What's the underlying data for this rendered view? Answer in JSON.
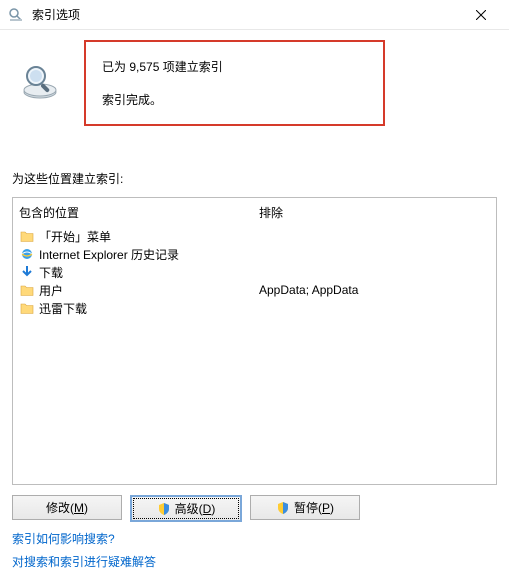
{
  "window": {
    "title": "索引选项"
  },
  "status": {
    "line1": "已为 9,575 项建立索引",
    "line2": "索引完成。"
  },
  "section_label": "为这些位置建立索引:",
  "columns": {
    "include": "包含的位置",
    "exclude": "排除"
  },
  "locations": [
    {
      "icon": "folder",
      "label": "「开始」菜单",
      "exclude": ""
    },
    {
      "icon": "ie",
      "label": "Internet Explorer 历史记录",
      "exclude": ""
    },
    {
      "icon": "download",
      "label": "下载",
      "exclude": ""
    },
    {
      "icon": "folder",
      "label": "用户",
      "exclude": "AppData; AppData"
    },
    {
      "icon": "folder",
      "label": "迅雷下载",
      "exclude": ""
    }
  ],
  "buttons": {
    "modify": "修改",
    "modify_key": "M",
    "advanced": "高级",
    "advanced_key": "D",
    "pause": "暂停",
    "pause_key": "P"
  },
  "links": {
    "help1": "索引如何影响搜索?",
    "help2": "对搜索和索引进行疑难解答"
  }
}
